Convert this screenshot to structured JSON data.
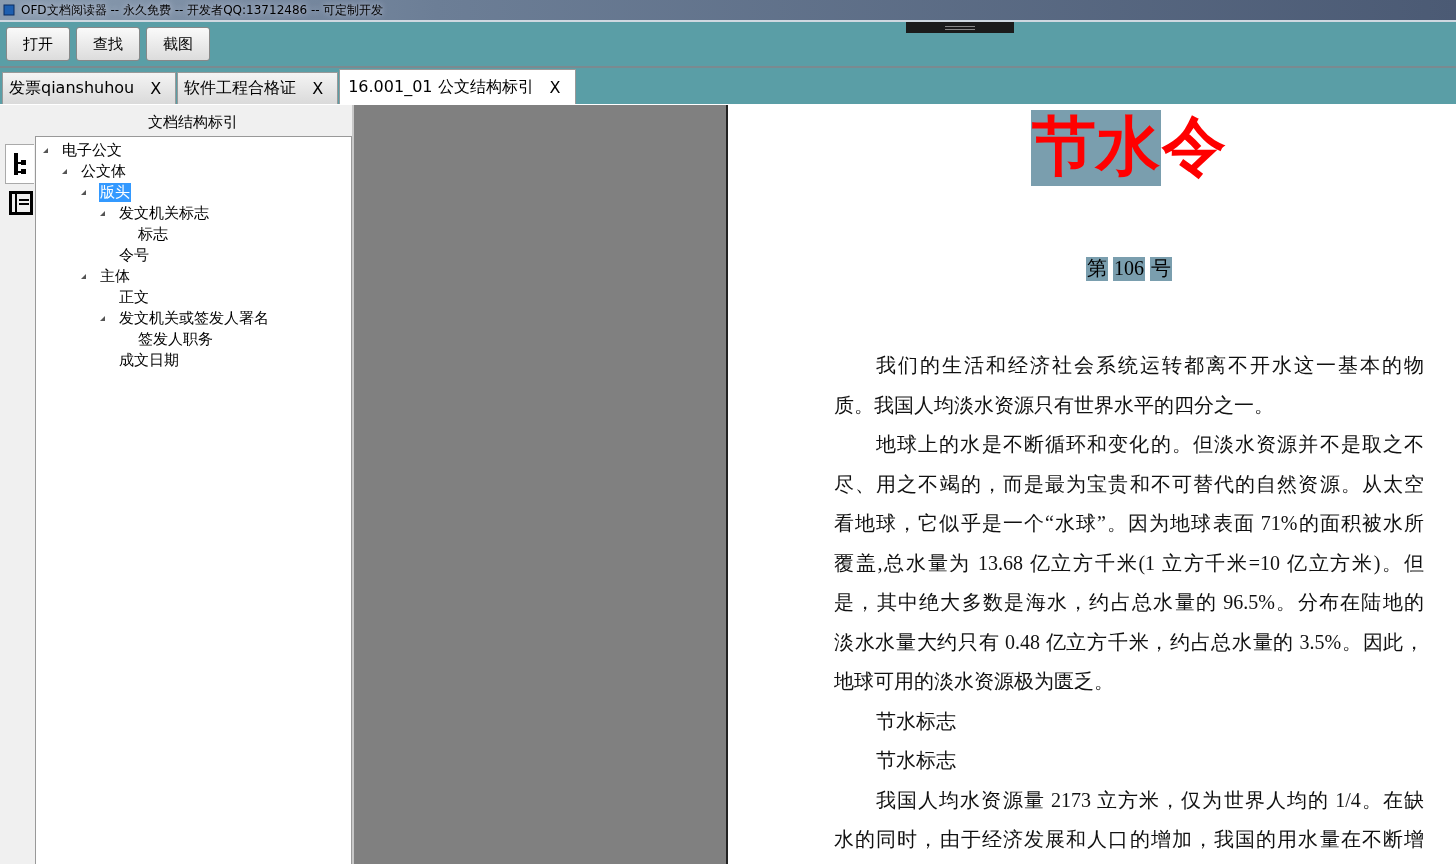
{
  "window": {
    "title": "OFD文档阅读器 -- 永久免费 -- 开发者QQ:13712486 -- 可定制开发"
  },
  "toolbar": {
    "buttons": [
      "打开",
      "查找",
      "截图"
    ]
  },
  "tabs": [
    {
      "label": "发票qianshuhou",
      "close": "X",
      "selected": false
    },
    {
      "label": "软件工程合格证",
      "close": "X",
      "selected": false
    },
    {
      "label": "16.001_01 公文结构标引",
      "close": "X",
      "selected": true
    }
  ],
  "sidebar": {
    "title": "文档结构标引",
    "side_tabs": [
      {
        "kind": "tree",
        "selected": true
      },
      {
        "kind": "page",
        "selected": false
      }
    ],
    "tree": [
      {
        "label": "电子公文",
        "expanded": true,
        "selected": false,
        "children": [
          {
            "label": "公文体",
            "expanded": true,
            "selected": false,
            "children": [
              {
                "label": "版头",
                "expanded": true,
                "selected": true,
                "children": [
                  {
                    "label": "发文机关标志",
                    "expanded": true,
                    "selected": false,
                    "children": [
                      {
                        "label": "标志",
                        "selected": false
                      }
                    ]
                  },
                  {
                    "label": "令号",
                    "selected": false
                  }
                ]
              },
              {
                "label": "主体",
                "expanded": true,
                "selected": false,
                "children": [
                  {
                    "label": "正文",
                    "selected": false
                  },
                  {
                    "label": "发文机关或签发人署名",
                    "expanded": true,
                    "selected": false,
                    "children": [
                      {
                        "label": "签发人职务",
                        "selected": false
                      }
                    ]
                  },
                  {
                    "label": "成文日期",
                    "selected": false
                  }
                ]
              }
            ]
          }
        ]
      }
    ]
  },
  "document": {
    "title": [
      {
        "text": "节水",
        "highlighted": true
      },
      {
        "text": "令",
        "highlighted": false
      }
    ],
    "number": [
      {
        "text": "第",
        "highlighted": true
      },
      {
        "text": "106",
        "highlighted": true
      },
      {
        "text": "号",
        "highlighted": true
      }
    ],
    "lines": [
      {
        "kind": "indented",
        "text": "我们的生活和经济社会系统运转都离不开水这一基本的物"
      },
      {
        "kind": "last",
        "text": "质。我国人均淡水资源只有世界水平的四分之一。"
      },
      {
        "kind": "indented",
        "text": "地球上的水是不断循环和变化的。但淡水资源并不是取之不"
      },
      {
        "kind": "full",
        "text": "尽、用之不竭的，而是最为宝贵和不可替代的自然资源。从太空"
      },
      {
        "kind": "full",
        "text": "看地球，它似乎是一个“水球”。因为地球表面 71%的面积被水所"
      },
      {
        "kind": "full",
        "text": "覆盖,总水量为 13.68 亿立方千米(1 立方千米=10 亿立方米)。但"
      },
      {
        "kind": "full",
        "text": "是，其中绝大多数是海水，约占总水量的 96.5%。分布在陆地的"
      },
      {
        "kind": "full",
        "text": "淡水水量大约只有 0.48 亿立方千米，约占总水量的 3.5%。因此，"
      },
      {
        "kind": "last",
        "text": "地球可用的淡水资源极为匮乏。"
      },
      {
        "kind": "indented-last",
        "text": "节水标志"
      },
      {
        "kind": "indented-last",
        "text": "节水标志"
      },
      {
        "kind": "indented",
        "text": "我国人均水资源量 2173 立方米，仅为世界人均的 1/4。在缺"
      },
      {
        "kind": "full",
        "text": "水的同时，由于经济发展和人口的增加，我国的用水量在不断增"
      }
    ]
  }
}
